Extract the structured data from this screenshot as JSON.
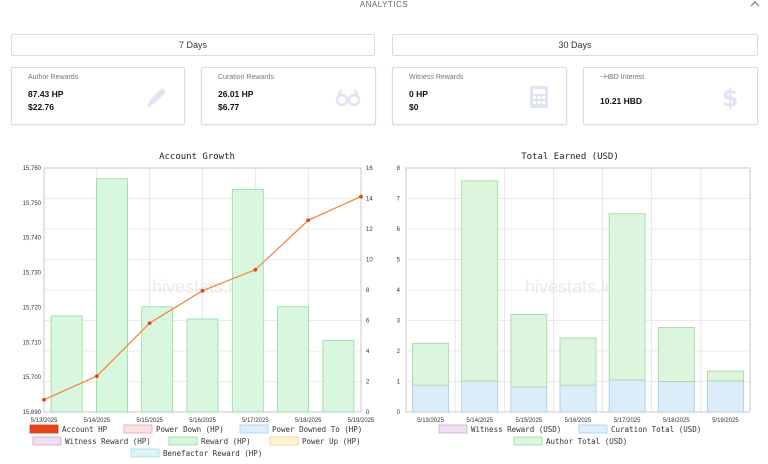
{
  "section": {
    "title": "ANALYTICS"
  },
  "periods": {
    "seven": "7 Days",
    "thirty": "30 Days"
  },
  "cards": [
    {
      "label": "Author Rewards",
      "v1": "87.43 HP",
      "v2": "$22.76",
      "icon": "pencil-icon"
    },
    {
      "label": "Curation Rewards",
      "v1": "26.01 HP",
      "v2": "$6.77",
      "icon": "glasses-icon"
    },
    {
      "label": "Witness Rewards",
      "v1": "0 HP",
      "v2": "$0",
      "icon": "calculator-icon"
    },
    {
      "label": "~HBD Interest",
      "v1": "10.21 HBD",
      "v2": "",
      "icon": "dollar-icon"
    }
  ],
  "colors": {
    "reward_fill": "#d9f7df",
    "reward_stroke": "#8fdc9e",
    "account_line": "#f0843a",
    "account_point": "#e04a1a",
    "curation_fill": "#dcedf9",
    "curation_stroke": "#9fcbe8",
    "author_fill": "#dcf5dc",
    "author_stroke": "#9fd79f"
  },
  "chart_data": [
    {
      "type": "bar",
      "title": "Account Growth",
      "watermark": "hivestats.io",
      "categories": [
        "5/13/2025",
        "5/14/2025",
        "5/15/2025",
        "5/16/2025",
        "5/17/2025",
        "5/18/2025",
        "5/19/2025"
      ],
      "series": [
        {
          "name": "Account HP",
          "type": "line",
          "axis": "left",
          "values": [
            15693.5,
            15700.3,
            15715.5,
            15724.8,
            15730.8,
            15745.0,
            15751.8
          ]
        },
        {
          "name": "Reward (HP)",
          "type": "bar",
          "axis": "right",
          "values": [
            6.3,
            15.3,
            6.9,
            6.1,
            14.6,
            6.9,
            4.7
          ]
        }
      ],
      "legend": [
        "Account HP",
        "Power Down (HP)",
        "Power Downed To (HP)",
        "Witness Reward (HP)",
        "Reward (HP)",
        "Power Up (HP)",
        "Benefactor Reward (HP)"
      ],
      "legend_position": "bottom",
      "y_left": {
        "ylim": [
          15690,
          15760
        ],
        "ticks": [
          "15,690",
          "15,700",
          "15,710",
          "15,720",
          "15,730",
          "15,740",
          "15,750",
          "15,760"
        ]
      },
      "y_right": {
        "ylim": [
          0,
          16
        ],
        "ticks": [
          "0",
          "2",
          "4",
          "6",
          "8",
          "10",
          "12",
          "14",
          "16"
        ]
      },
      "grid": true
    },
    {
      "type": "bar",
      "title": "Total Earned (USD)",
      "watermark": "hivestats.io",
      "categories": [
        "5/13/2025",
        "5/14/2025",
        "5/15/2025",
        "5/16/2025",
        "5/17/2025",
        "5/18/2025",
        "5/19/2025"
      ],
      "series": [
        {
          "name": "Curation Total (USD)",
          "values": [
            0.88,
            1.02,
            0.82,
            0.88,
            1.05,
            1.0,
            1.02
          ]
        },
        {
          "name": "Author Total (USD)",
          "values": [
            1.37,
            6.56,
            2.38,
            1.55,
            5.45,
            1.77,
            0.32
          ]
        }
      ],
      "stacked": true,
      "legend": [
        "Witness Reward (USD)",
        "Curation Total (USD)",
        "Author Total (USD)"
      ],
      "legend_position": "bottom",
      "ylim": [
        0,
        8
      ],
      "ticks": [
        "0",
        "1",
        "2",
        "3",
        "4",
        "5",
        "6",
        "7",
        "8"
      ],
      "grid": true
    }
  ],
  "legend_colors": {
    "Account HP": [
      "#e8431b",
      "#d23a12"
    ],
    "Power Down (HP)": [
      "#fde1e4",
      "#f2a1aa"
    ],
    "Power Downed To (HP)": [
      "#dfeefb",
      "#a7cdee"
    ],
    "Witness Reward (HP)": [
      "#efe0f2",
      "#c9a6d1"
    ],
    "Reward (HP)": [
      "#d9f7df",
      "#8fdc9e"
    ],
    "Power Up (HP)": [
      "#fff4d6",
      "#f1d28a"
    ],
    "Benefactor Reward (HP)": [
      "#def4f4",
      "#a1dcdc"
    ],
    "Witness Reward (USD)": [
      "#efe0f2",
      "#c9a6d1"
    ],
    "Curation Total (USD)": [
      "#dfeefb",
      "#a7cdee"
    ],
    "Author Total (USD)": [
      "#dcf5dc",
      "#9fd79f"
    ]
  }
}
